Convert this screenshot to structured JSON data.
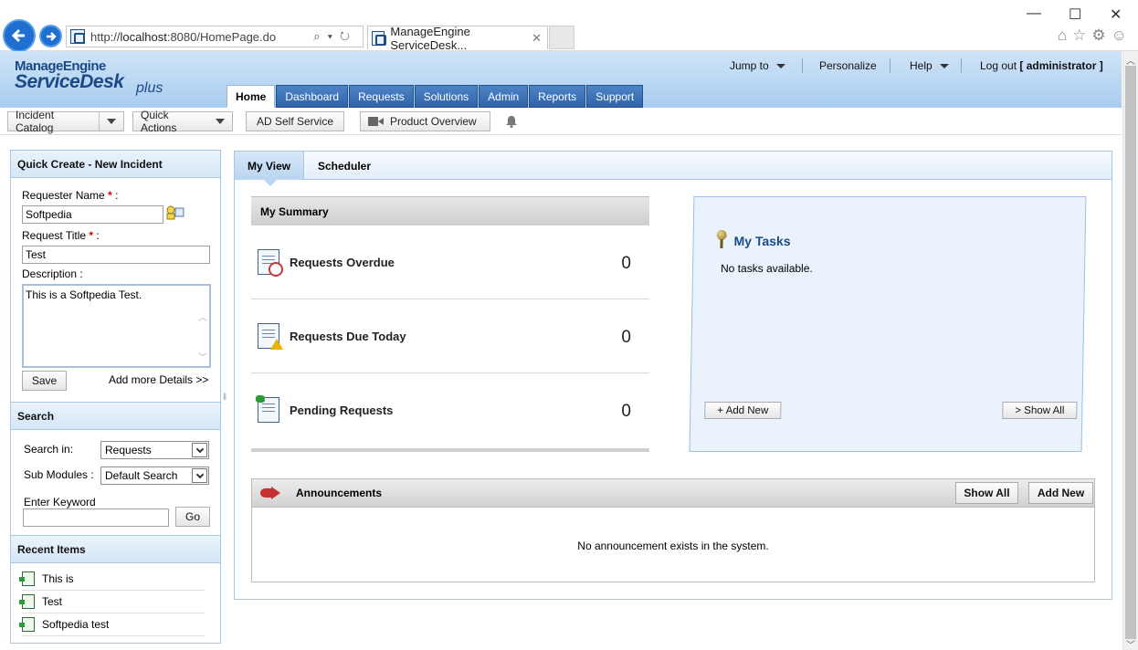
{
  "browser": {
    "url_prefix": "http://",
    "url_host": "localhost",
    "url_rest": ":8080/HomePage.do",
    "tab_title": "ManageEngine ServiceDesk...",
    "tab_close": "✕"
  },
  "logo": {
    "line1": "ManageEngine",
    "line2": "ServiceDesk",
    "plus": "plus"
  },
  "header": {
    "jump_to": "Jump to",
    "personalize": "Personalize",
    "help": "Help",
    "logout": "Log out",
    "user": "[ administrator ]"
  },
  "main_tabs": [
    "Home",
    "Dashboard",
    "Requests",
    "Solutions",
    "Admin",
    "Reports",
    "Support"
  ],
  "toolbar": {
    "incident_catalog": "Incident Catalog",
    "quick_actions": "Quick Actions",
    "ad_self_service": "AD Self Service",
    "product_overview": "Product Overview"
  },
  "quick_create": {
    "title": "Quick Create - New Incident",
    "requester_label": "Requester Name",
    "requester_value": "Softpedia",
    "title_label": "Request Title",
    "title_value": "Test",
    "desc_label": "Description :",
    "desc_value": "This is a Softpedia Test.",
    "save": "Save",
    "more_details": "Add more Details >>",
    "required_mark": "*",
    "colon": " :"
  },
  "search": {
    "title": "Search",
    "search_in_label": "Search in:",
    "search_in_value": "Requests",
    "sub_modules_label": "Sub Modules :",
    "sub_modules_value": "Default Search",
    "keyword_label": "Enter Keyword",
    "go": "Go"
  },
  "recent": {
    "title": "Recent Items",
    "items": [
      "This is",
      "Test",
      "Softpedia test"
    ]
  },
  "view_tabs": {
    "my_view": "My View",
    "scheduler": "Scheduler"
  },
  "summary": {
    "title": "My Summary",
    "rows": [
      {
        "label": "Requests Overdue",
        "count": "0"
      },
      {
        "label": "Requests Due Today",
        "count": "0"
      },
      {
        "label": "Pending Requests",
        "count": "0"
      }
    ]
  },
  "tasks": {
    "title": "My Tasks",
    "empty": "No tasks available.",
    "add_new": "+ Add New",
    "show_all": "> Show All"
  },
  "announcements": {
    "title": "Announcements",
    "show_all": "Show All",
    "add_new": "Add New",
    "empty": "No announcement exists in the system."
  },
  "icons": {
    "back": "arrow-left-icon",
    "forward": "arrow-right-icon",
    "bell": "bell-icon",
    "pin": "pushpin-icon",
    "megaphone": "megaphone-icon"
  },
  "colors": {
    "accent": "#2f64a8",
    "header_bg": "#bcd8f3",
    "brand": "#1b4a86"
  }
}
